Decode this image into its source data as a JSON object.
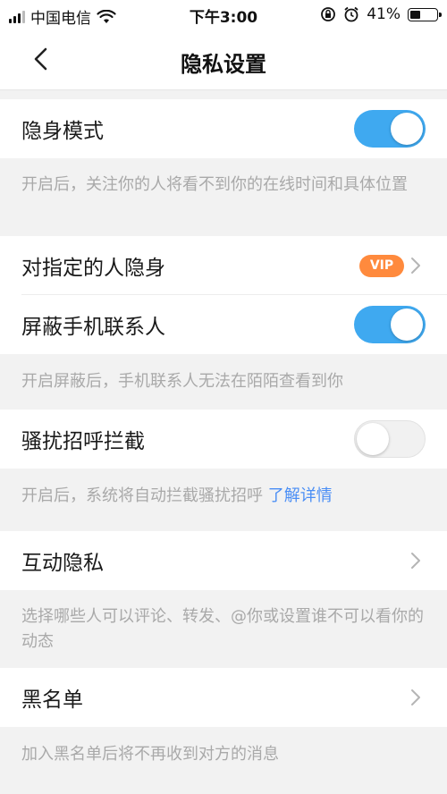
{
  "status_bar": {
    "carrier": "中国电信",
    "time": "下午3:00",
    "battery": "41%",
    "battery_level": 0.41,
    "icons": [
      "signal-icon",
      "wifi-icon",
      "rotation-lock-icon",
      "alarm-icon",
      "battery-icon"
    ]
  },
  "nav": {
    "title": "隐私设置",
    "back_icon": "chevron-left-icon"
  },
  "settings": {
    "stealth_mode": {
      "label": "隐身模式",
      "enabled": true,
      "description": "开启后，关注你的人将看不到你的在线时间和具体位置"
    },
    "stealth_specific": {
      "label": "对指定的人隐身",
      "badge": "VIP"
    },
    "block_contacts": {
      "label": "屏蔽手机联系人",
      "enabled": true,
      "description": "开启屏蔽后，手机联系人无法在陌陌查看到你"
    },
    "harassment_block": {
      "label": "骚扰招呼拦截",
      "enabled": false,
      "description": "开启后，系统将自动拦截骚扰招呼",
      "link_text": "了解详情"
    },
    "interaction_privacy": {
      "label": "互动隐私",
      "description": "选择哪些人可以评论、转发、@你或设置谁不可以看你的动态"
    },
    "blacklist": {
      "label": "黑名单",
      "description": "加入黑名单后将不再收到对方的消息"
    }
  },
  "colors": {
    "toggle_on": "#3fa9f0",
    "vip_badge": "#ff8a3d",
    "link": "#4a8ef5"
  }
}
